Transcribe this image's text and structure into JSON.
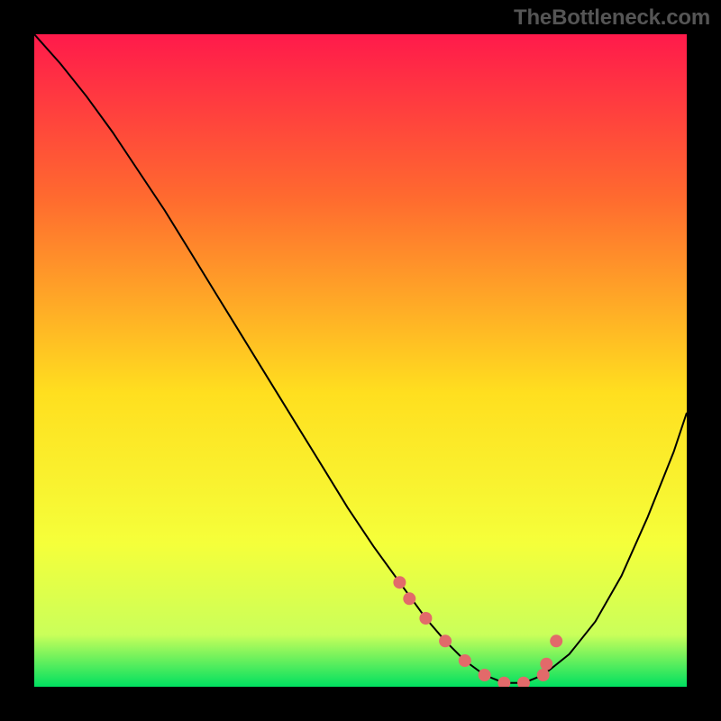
{
  "watermark": "TheBottleneck.com",
  "chart_data": {
    "type": "line",
    "title": "",
    "xlabel": "",
    "ylabel": "",
    "xlim": [
      0,
      100
    ],
    "ylim": [
      0,
      100
    ],
    "grid": false,
    "legend": false,
    "background_gradient": {
      "stops": [
        {
          "offset": 0.0,
          "color": "#ff1a4b"
        },
        {
          "offset": 0.25,
          "color": "#ff6a2f"
        },
        {
          "offset": 0.55,
          "color": "#ffdf1f"
        },
        {
          "offset": 0.78,
          "color": "#f5ff3a"
        },
        {
          "offset": 0.92,
          "color": "#caff5a"
        },
        {
          "offset": 1.0,
          "color": "#00e060"
        }
      ]
    },
    "series": [
      {
        "name": "curve",
        "stroke": "#000000",
        "stroke_width": 2,
        "x": [
          0,
          4,
          8,
          12,
          16,
          20,
          24,
          28,
          32,
          36,
          40,
          44,
          48,
          52,
          56,
          60,
          63,
          66,
          69,
          72,
          75,
          78,
          82,
          86,
          90,
          94,
          98,
          100
        ],
        "y": [
          100,
          95.5,
          90.5,
          85,
          79,
          73,
          66.5,
          60,
          53.5,
          47,
          40.5,
          34,
          27.5,
          21.5,
          16,
          10.5,
          7,
          4,
          1.8,
          0.6,
          0.6,
          1.8,
          5,
          10,
          17,
          26,
          36,
          42
        ]
      }
    ],
    "markers": {
      "name": "dots",
      "fill": "#e26a6a",
      "radius": 7,
      "x": [
        56,
        57.5,
        60,
        63,
        66,
        69,
        72,
        75,
        78,
        78.5,
        80
      ],
      "y": [
        16,
        13.5,
        10.5,
        7,
        4,
        1.8,
        0.6,
        0.6,
        1.8,
        3.5,
        7
      ]
    }
  }
}
